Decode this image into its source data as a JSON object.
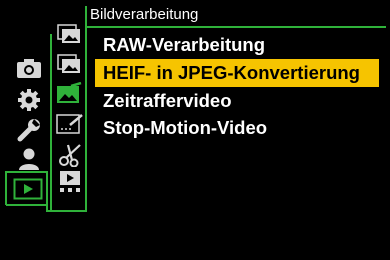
{
  "header": {
    "title": "Bildverarbeitung"
  },
  "menu": {
    "items": [
      {
        "label": "RAW-Verarbeitung",
        "selected": false
      },
      {
        "label": "HEIF- in JPEG-Konvertierung",
        "selected": true
      },
      {
        "label": "Zeitraffervideo",
        "selected": false
      },
      {
        "label": "Stop-Motion-Video",
        "selected": false
      }
    ]
  },
  "sidebar": {
    "main_tabs": [
      "camera-icon",
      "gear-icon",
      "wrench-icon",
      "person-icon",
      "playback-icon"
    ],
    "active_main_tab": "playback-icon",
    "sub_tabs": [
      "image-stack-icon",
      "image-stack-icon",
      "image-edit-icon",
      "text-edit-icon",
      "scissors-icon",
      "slideshow-icon"
    ],
    "active_sub_tab": "image-edit-icon"
  },
  "colors": {
    "accent": "#2fb23a",
    "selection": "#f6c400",
    "background": "#000000"
  }
}
